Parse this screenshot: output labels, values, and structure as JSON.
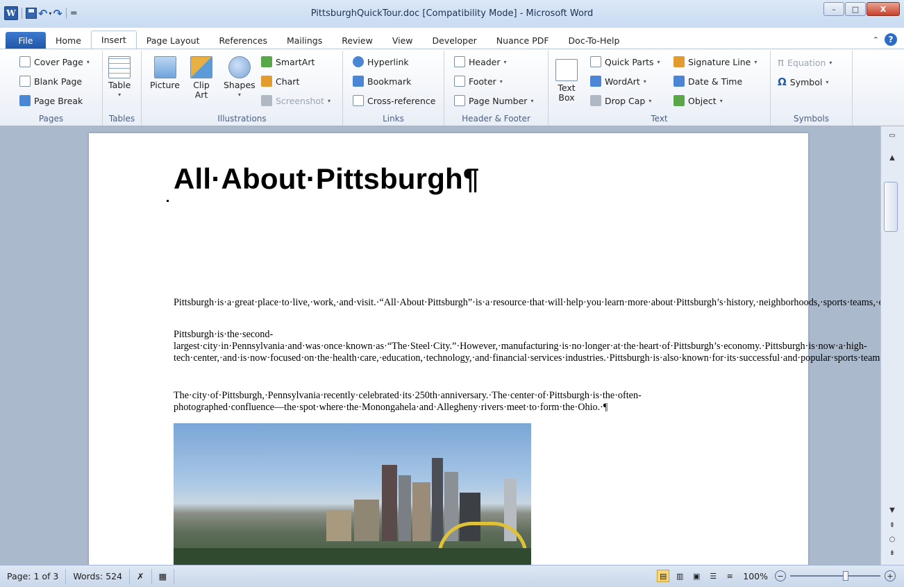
{
  "window": {
    "title": "PittsburghQuickTour.doc [Compatibility Mode] - Microsoft Word",
    "app_icon_letter": "W",
    "controls": {
      "minimize": "–",
      "maximize": "□",
      "close": "X"
    }
  },
  "quick_access": {
    "save": "",
    "undo": "↶",
    "redo": "↷",
    "dropdown": "▾",
    "customize": "="
  },
  "tabs": [
    {
      "label": "File"
    },
    {
      "label": "Home"
    },
    {
      "label": "Insert"
    },
    {
      "label": "Page Layout"
    },
    {
      "label": "References"
    },
    {
      "label": "Mailings"
    },
    {
      "label": "Review"
    },
    {
      "label": "View"
    },
    {
      "label": "Developer"
    },
    {
      "label": "Nuance PDF"
    },
    {
      "label": "Doc-To-Help"
    }
  ],
  "ribbon": {
    "pages": {
      "label": "Pages",
      "cover_page": "Cover Page",
      "blank_page": "Blank Page",
      "page_break": "Page Break"
    },
    "tables": {
      "label": "Tables",
      "table": "Table"
    },
    "illustrations": {
      "label": "Illustrations",
      "picture": "Picture",
      "clip_art": "Clip\nArt",
      "shapes": "Shapes",
      "smartart": "SmartArt",
      "chart": "Chart",
      "screenshot": "Screenshot"
    },
    "links": {
      "label": "Links",
      "hyperlink": "Hyperlink",
      "bookmark": "Bookmark",
      "cross_reference": "Cross-reference"
    },
    "header_footer": {
      "label": "Header & Footer",
      "header": "Header",
      "footer": "Footer",
      "page_number": "Page Number"
    },
    "text": {
      "label": "Text",
      "text_box": "Text\nBox",
      "quick_parts": "Quick Parts",
      "wordart": "WordArt",
      "drop_cap": "Drop Cap",
      "signature_line": "Signature Line",
      "date_time": "Date & Time",
      "object": "Object"
    },
    "symbols": {
      "label": "Symbols",
      "equation": "Equation",
      "symbol": "Symbol"
    }
  },
  "document": {
    "title": "All·About·Pittsburgh¶",
    "paragraphs": [
      "Pittsburgh·is·a·great·place·to·live,·work,·and·visit.·“All·About·Pittsburgh”·is·a·resource·that·will·help·you·learn·more·about·Pittsburgh’s·history,·neighborhoods,·sports·teams,·colleges·and·universities,·popular·attractions,·and·more.·¶",
      "Pittsburgh·is·the·second-largest·city·in·Pennsylvania·and·was·once·known·as·“The·Steel·City.”·However,·manufacturing·is·no·longer·at·the·heart·of·Pittsburgh’s·economy.·Pittsburgh·is·now·a·high-tech·center,·and·is·now·focused·on·the·health·care,·education,·technology,·and·financial·services·industries.·Pittsburgh·is·also·known·for·its·successful·and·popular·sports·teams.¶",
      "The·city·of·Pittsburgh,·Pennsylvania·recently·celebrated·its·250th·anniversary.·The·center·of·Pittsburgh·is·the·often-photographed·confluence—the·spot·where·the·Monongahela·and·Allegheny·rivers·meet·to·form·the·Ohio.·¶"
    ]
  },
  "status": {
    "page": "Page: 1 of 3",
    "words": "Words: 524",
    "zoom": "100%",
    "zoom_minus": "−",
    "zoom_plus": "+"
  }
}
